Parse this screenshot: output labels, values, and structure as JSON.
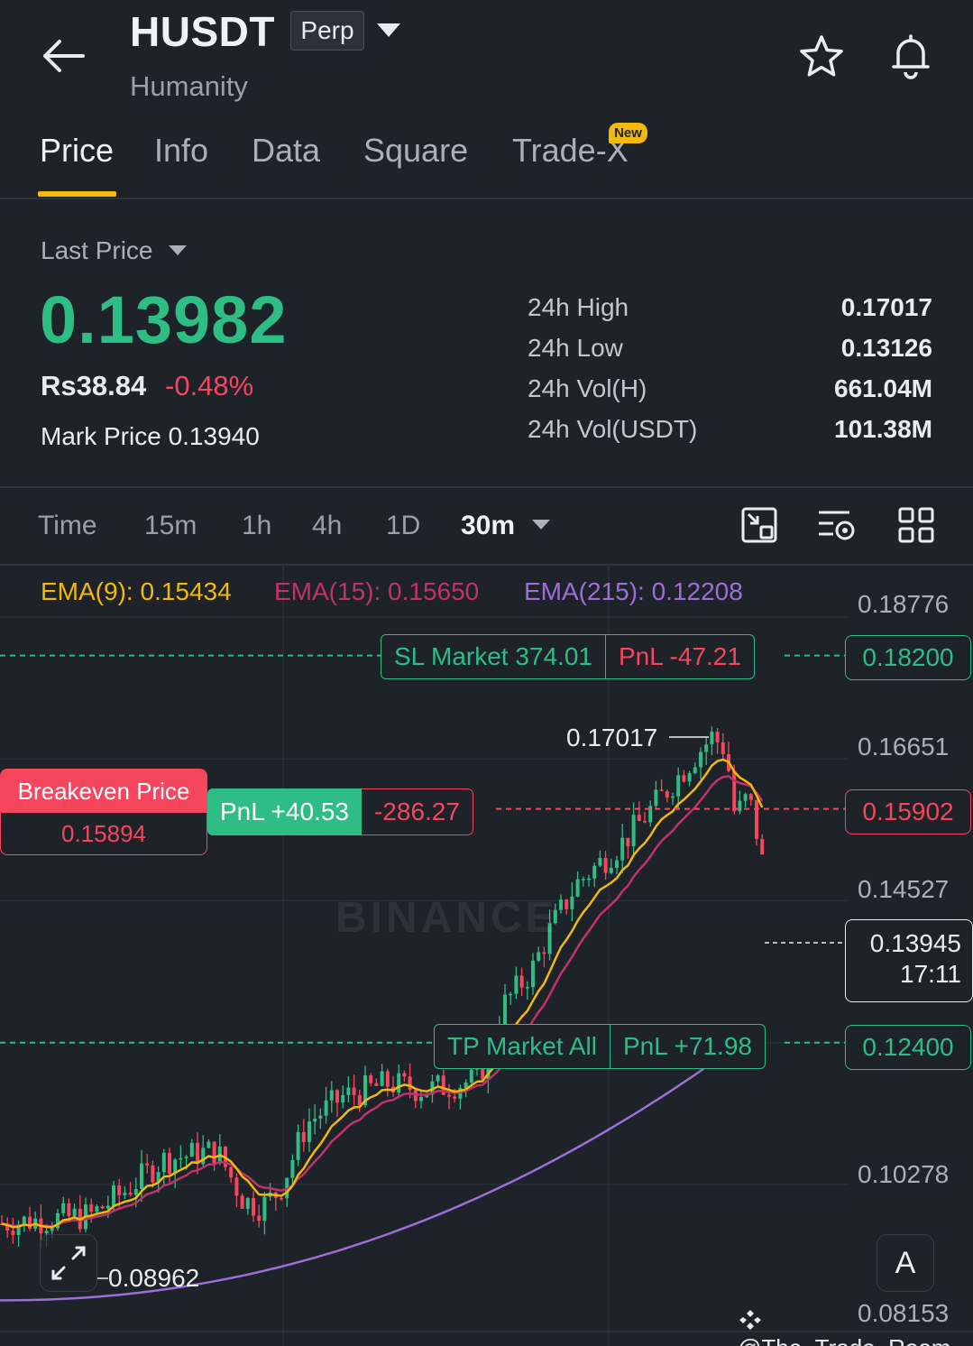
{
  "header": {
    "symbol": "HUSDT",
    "contract_type": "Perp",
    "name": "Humanity"
  },
  "tabs": [
    {
      "label": "Price",
      "active": true
    },
    {
      "label": "Info"
    },
    {
      "label": "Data"
    },
    {
      "label": "Square"
    },
    {
      "label": "Trade-X",
      "badge": "New"
    }
  ],
  "price": {
    "label": "Last Price",
    "last": "0.13982",
    "fiat": "Rs38.84",
    "change_pct": "-0.48%",
    "mark_label": "Mark Price",
    "mark": "0.13940"
  },
  "stats": [
    {
      "label": "24h High",
      "value": "0.17017"
    },
    {
      "label": "24h Low",
      "value": "0.13126"
    },
    {
      "label": "24h Vol(H)",
      "value": "661.04M"
    },
    {
      "label": "24h Vol(USDT)",
      "value": "101.38M"
    }
  ],
  "intervals": [
    "Time",
    "15m",
    "1h",
    "4h",
    "1D",
    "30m"
  ],
  "chart": {
    "ema9": "EMA(9): 0.15434",
    "ema15": "EMA(15): 0.15650",
    "ema215": "EMA(215): 0.12208",
    "axis": [
      "0.18776",
      "0.16651",
      "0.14527",
      "0.10278",
      "0.08153"
    ],
    "sl": {
      "label": "SL Market 374.01",
      "pnl": "PnL -47.21",
      "price": "0.18200"
    },
    "tp": {
      "label": "TP Market All",
      "pnl": "PnL +71.98",
      "price": "0.12400"
    },
    "breakeven": {
      "title": "Breakeven Price",
      "value": "0.15894"
    },
    "position": {
      "pnl": "PnL +40.53",
      "qty": "-286.27",
      "price": "0.15902"
    },
    "last_tag": {
      "price": "0.13945",
      "countdown": "17:11"
    },
    "high_label": "0.17017",
    "low_label": "0.08962",
    "a_button": "A",
    "brand_watermark": "BINANCE"
  },
  "colors": {
    "up": "#2ebd85",
    "down": "#f6465d",
    "accent": "#f0b90b",
    "ema9": "#f0b90b",
    "ema15": "#c0336a",
    "ema215": "#9b6fd6"
  },
  "watermark": "@The_Trade_Room"
}
